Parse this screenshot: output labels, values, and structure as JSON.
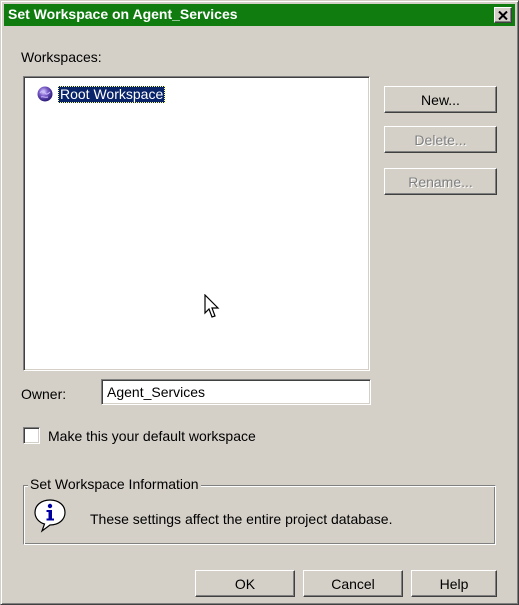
{
  "window": {
    "title": "Set Workspace on Agent_Services",
    "titlebar_color": "#107c10"
  },
  "workspaces": {
    "label": "Workspaces:",
    "items": [
      {
        "label": "Root Workspace",
        "icon": "globe-icon",
        "selected": true
      }
    ]
  },
  "buttons": {
    "new_label": "New...",
    "delete_label": "Delete...",
    "rename_label": "Rename...",
    "ok_label": "OK",
    "cancel_label": "Cancel",
    "help_label": "Help"
  },
  "owner": {
    "label": "Owner:",
    "value": "Agent_Services"
  },
  "default_checkbox": {
    "label": "Make this your default workspace",
    "checked": false
  },
  "info_group": {
    "title": "Set Workspace Information",
    "icon": "info-icon",
    "message": "These settings affect the entire project database."
  }
}
